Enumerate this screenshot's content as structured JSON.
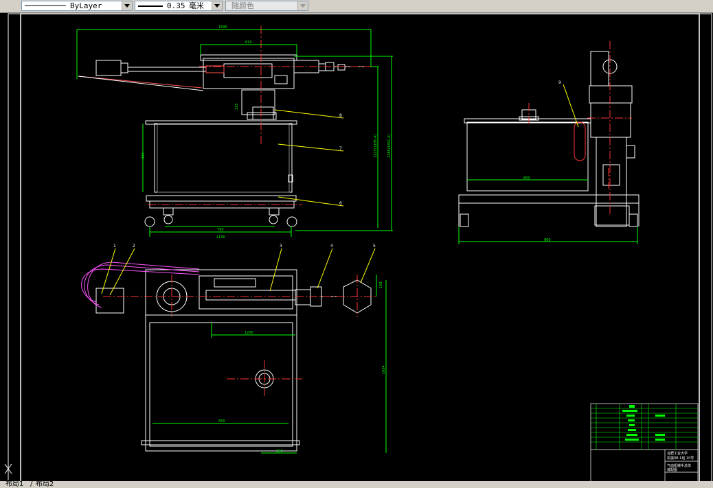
{
  "toolbar": {
    "linetype_label": "ByLayer",
    "lineweight_value": "0.35",
    "lineweight_unit": "毫米",
    "color_label": "随颜色"
  },
  "drawing": {
    "balloons": [
      "1",
      "2",
      "3",
      "4",
      "5",
      "6",
      "7",
      "8",
      "9"
    ],
    "front_dims": {
      "overall_width": "1595",
      "carriage": "610",
      "base_width": "1100",
      "wheel_span": "750",
      "box_height": "399",
      "col_height": "225"
    },
    "side_dims": {
      "box_width": "800",
      "base_width": "900"
    },
    "plan_dims": {
      "rail": "1200",
      "depth": "1634",
      "box_width": "550",
      "small": "250",
      "grip": "158"
    },
    "vertical_dims": {
      "total_a": "1225(1185.4)",
      "total_b": "1185(1651.4)"
    }
  },
  "colors": {
    "bg": "#000000",
    "line": "#ffffff",
    "dim": "#00ff00",
    "center": "#ff0000",
    "leader": "#ffff00",
    "hatch": "#ff00ff",
    "highlight": "#00ff00"
  },
  "title_block": {
    "school": "合肥工业大学",
    "class_line": "机械08-1班 10号",
    "drawing_name": "气动机械手总体",
    "drawing_type": "装配图"
  },
  "layout_tabs": [
    "布局1",
    "布局2"
  ]
}
